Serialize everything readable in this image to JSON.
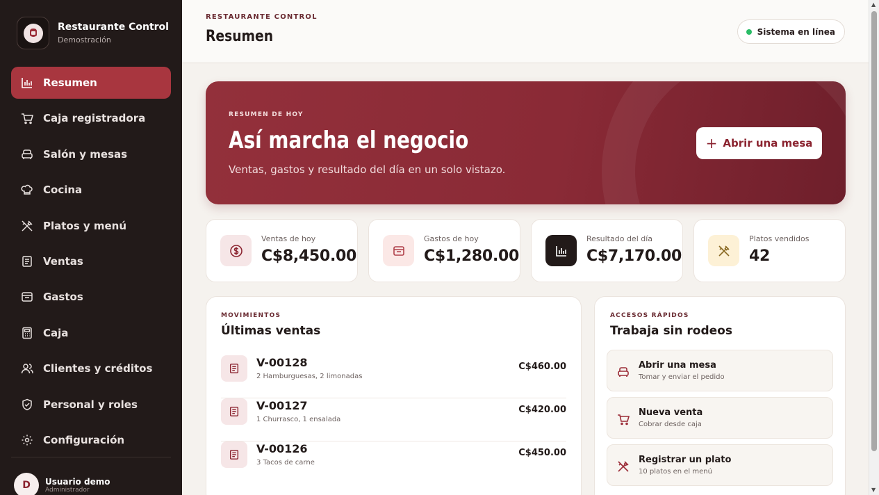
{
  "sidebar": {
    "brand_title": "Restaurante Control",
    "brand_subtitle": "Demostración",
    "items": [
      {
        "label": "Resumen",
        "icon": "bar-chart-icon",
        "active": true
      },
      {
        "label": "Caja registradora",
        "icon": "cart-icon"
      },
      {
        "label": "Salón y mesas",
        "icon": "sofa-icon"
      },
      {
        "label": "Cocina",
        "icon": "chef-hat-icon"
      },
      {
        "label": "Platos y menú",
        "icon": "utensils-icon"
      },
      {
        "label": "Ventas",
        "icon": "receipt-icon"
      },
      {
        "label": "Gastos",
        "icon": "wallet-icon"
      },
      {
        "label": "Caja",
        "icon": "calculator-icon"
      },
      {
        "label": "Clientes y créditos",
        "icon": "users-icon"
      },
      {
        "label": "Personal y roles",
        "icon": "shield-icon"
      },
      {
        "label": "Configuración",
        "icon": "gear-icon"
      }
    ],
    "user": {
      "initial": "D",
      "name": "Usuario demo",
      "role": "Administrador"
    }
  },
  "header": {
    "eyebrow": "RESTAURANTE CONTROL",
    "title": "Resumen",
    "status": "Sistema en línea",
    "status_color": "#2bbd67"
  },
  "hero": {
    "eyebrow": "RESUMEN DE HOY",
    "title": "Así marcha el negocio",
    "subtitle": "Ventas, gastos y resultado del día en un solo vistazo.",
    "button": "Abrir una mesa"
  },
  "stats": [
    {
      "label": "Ventas de hoy",
      "value": "C$8,450.00",
      "icon": "dollar-icon"
    },
    {
      "label": "Gastos de hoy",
      "value": "C$1,280.00",
      "icon": "wallet-icon"
    },
    {
      "label": "Resultado del día",
      "value": "C$7,170.00",
      "icon": "bar-chart-icon"
    },
    {
      "label": "Platos vendidos",
      "value": "42",
      "icon": "utensils-icon"
    }
  ],
  "sales": {
    "eyebrow": "MOVIMIENTOS",
    "title": "Últimas ventas",
    "rows": [
      {
        "id": "V-00128",
        "desc": "2 Hamburguesas, 2 limonadas",
        "amount": "C$460.00"
      },
      {
        "id": "V-00127",
        "desc": "1 Churrasco, 1 ensalada",
        "amount": "C$420.00"
      },
      {
        "id": "V-00126",
        "desc": "3 Tacos de carne",
        "amount": "C$450.00"
      }
    ]
  },
  "quick": {
    "eyebrow": "ACCESOS RÁPIDOS",
    "title": "Trabaja sin rodeos",
    "items": [
      {
        "title": "Abrir una mesa",
        "sub": "Tomar y enviar el pedido",
        "icon": "sofa-icon"
      },
      {
        "title": "Nueva venta",
        "sub": "Cobrar desde caja",
        "icon": "cart-icon"
      },
      {
        "title": "Registrar un plato",
        "sub": "10 platos en el menú",
        "icon": "utensils-icon"
      }
    ]
  },
  "colors": {
    "accent": "#a8363f",
    "sidebar": "#221a19",
    "hero": "#8a2a36"
  }
}
